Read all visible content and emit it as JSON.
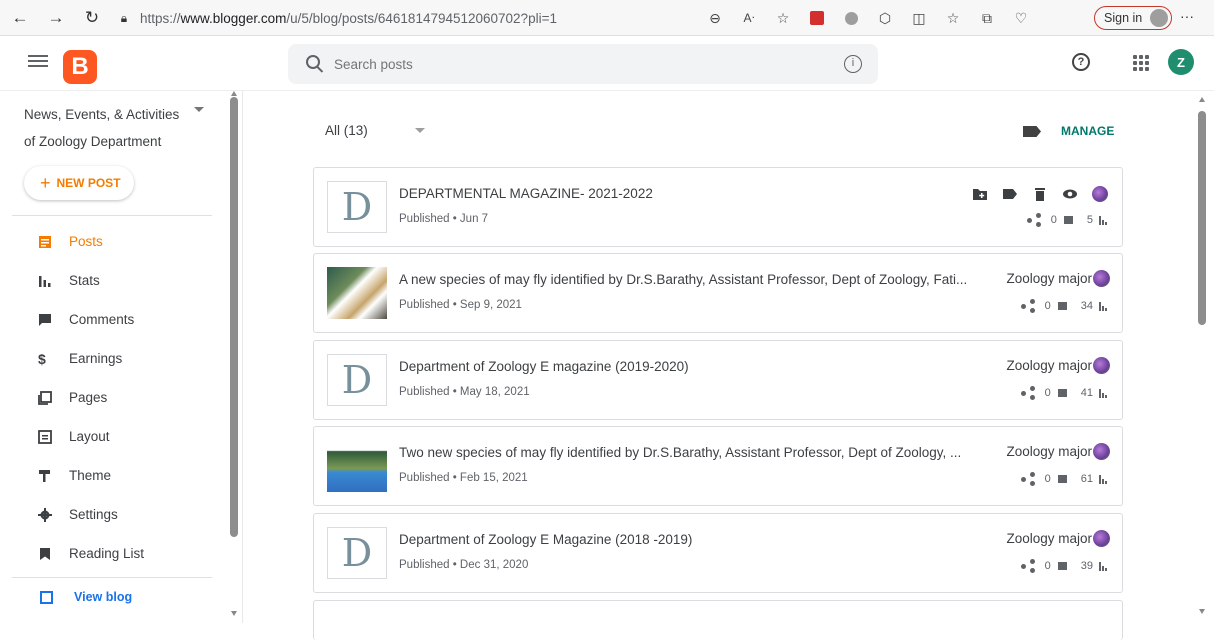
{
  "browser": {
    "url_prefix": "https://",
    "url_host": "www.blogger.com",
    "url_path": "/u/5/blog/posts/6461814794512060702?pli=1",
    "sign_in_label": "Sign in",
    "more_label": "···"
  },
  "header": {
    "logo_letter": "B",
    "search_placeholder": "Search posts",
    "help_label": "?",
    "user_initial": "Z"
  },
  "sidebar": {
    "blog_title": "News, Events, & Activities of Zoology Department",
    "new_post_label": "NEW POST",
    "items": [
      {
        "label": "Posts",
        "icon": "posts-icon",
        "active": true
      },
      {
        "label": "Stats",
        "icon": "stats-icon"
      },
      {
        "label": "Comments",
        "icon": "comment-icon"
      },
      {
        "label": "Earnings",
        "icon": "dollar-icon"
      },
      {
        "label": "Pages",
        "icon": "pages-icon"
      },
      {
        "label": "Layout",
        "icon": "layout-icon"
      },
      {
        "label": "Theme",
        "icon": "paint-roller-icon"
      },
      {
        "label": "Settings",
        "icon": "gear-icon"
      },
      {
        "label": "Reading List",
        "icon": "bookmark-icon"
      }
    ],
    "view_blog_label": "View blog"
  },
  "main": {
    "filter_label": "All (13)",
    "manage_label": "MANAGE",
    "posts": [
      {
        "title": "DEPARTMENTAL MAGAZINE- 2021-2022",
        "status": "Published • Jun 7",
        "author": "",
        "comments": "0",
        "views": "5",
        "thumb": "D"
      },
      {
        "title": "A new species of may fly identified by Dr.S.Barathy, Assistant Professor, Dept of Zoology, Fati...",
        "status": "Published • Sep 9, 2021",
        "author": "Zoology major",
        "comments": "0",
        "views": "34",
        "thumb": ""
      },
      {
        "title": "Department of Zoology E magazine (2019-2020)",
        "status": "Published • May 18, 2021",
        "author": "Zoology major",
        "comments": "0",
        "views": "41",
        "thumb": "D"
      },
      {
        "title": "Two new species of may fly identified by Dr.S.Barathy, Assistant Professor, Dept of Zoology, ...",
        "status": "Published • Feb 15, 2021",
        "author": "Zoology major",
        "comments": "0",
        "views": "61",
        "thumb": ""
      },
      {
        "title": "Department of Zoology E Magazine (2018 -2019)",
        "status": "Published • Dec 31, 2020",
        "author": "Zoology major",
        "comments": "0",
        "views": "39",
        "thumb": "D"
      }
    ]
  },
  "colors": {
    "accent": "#f57c00",
    "brand": "#ff5722",
    "link": "#1a73e8",
    "manage": "#00796b"
  }
}
